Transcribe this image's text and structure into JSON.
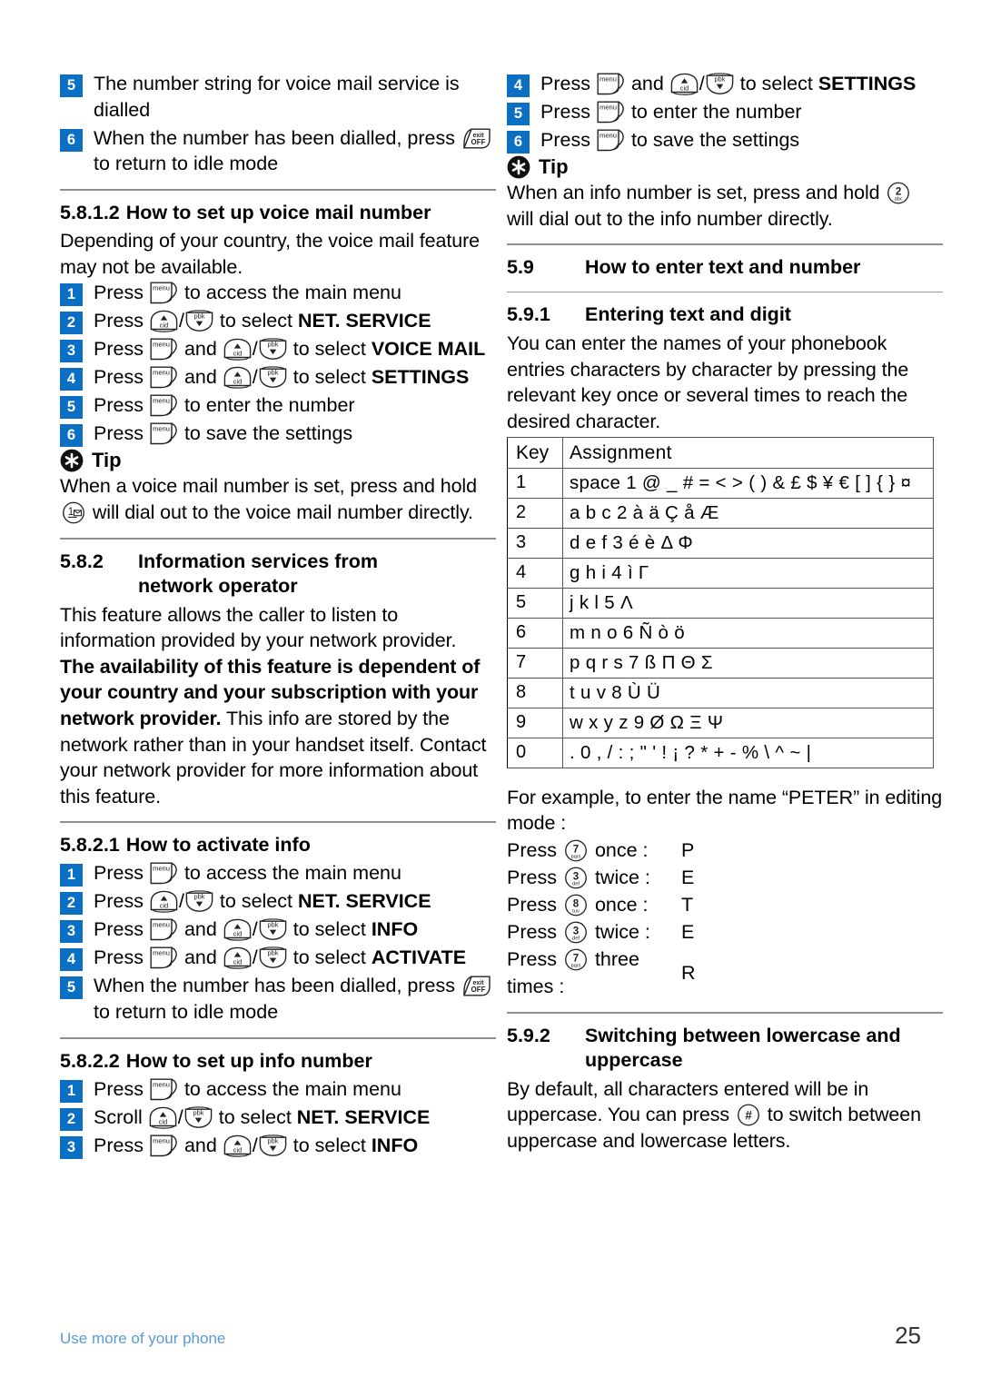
{
  "footer": {
    "left": "Use more of your phone",
    "page": "25"
  },
  "colors": {
    "step_badge": "#0b6fc4",
    "footer_link": "#5b9bd5",
    "rule": "#8e8e8e"
  },
  "left_column": {
    "steps_continued": [
      {
        "num": "5",
        "text": "The number string for voice mail service is dialled"
      },
      {
        "num": "6",
        "pre": "When the number has been dialled, press",
        "icon": "exit-off-key-icon",
        "post": "to return to idle mode"
      }
    ],
    "s_58_1_2": {
      "number": "5.8.1.2",
      "title": "How to set up voice mail number",
      "intro": "Depending of your country, the voice mail feature may not be available.",
      "steps": [
        {
          "num": "1",
          "pre": "Press",
          "icons": [
            "menu-key-icon"
          ],
          "post": "to access the main menu"
        },
        {
          "num": "2",
          "pre": "Press",
          "icons": [
            "up-cid-key-icon",
            "down-pbk-key-icon"
          ],
          "post": "to select",
          "bold": "NET. SERVICE"
        },
        {
          "num": "3",
          "pre": "Press",
          "icons": [
            "menu-key-icon",
            "up-cid-key-icon",
            "down-pbk-key-icon"
          ],
          "mid": "and",
          "post": "to select",
          "bold": "VOICE MAIL"
        },
        {
          "num": "4",
          "pre": "Press",
          "icons": [
            "menu-key-icon",
            "up-cid-key-icon",
            "down-pbk-key-icon"
          ],
          "mid": "and",
          "post": "to select",
          "bold": "SETTINGS"
        },
        {
          "num": "5",
          "pre": "Press",
          "icons": [
            "menu-key-icon"
          ],
          "post": "to enter the number"
        },
        {
          "num": "6",
          "pre": "Press",
          "icons": [
            "menu-key-icon"
          ],
          "post": "to save the settings"
        }
      ],
      "tip": {
        "label": "Tip",
        "text_a": "When a voice mail number is set, press and hold",
        "icon": "voicemail-1-key-icon",
        "text_b": "will dial out to the voice mail number directly."
      }
    },
    "s_58_2": {
      "number": "5.8.2",
      "title_line1": "Information services from",
      "title_line2": "network operator",
      "body_a": "This feature allows the caller to listen to information provided by your network provider.",
      "body_bold": "The availability of this feature is dependent of your country and your subscription with your network provider.",
      "body_b": "This info are stored by the network rather than in your handset itself. Contact your network provider for more information about this feature."
    },
    "s_58_2_1": {
      "number": "5.8.2.1",
      "title": "How to activate info",
      "steps": [
        {
          "num": "1",
          "pre": "Press",
          "icons": [
            "menu-key-icon"
          ],
          "post": "to access the main menu"
        },
        {
          "num": "2",
          "pre": "Press",
          "icons": [
            "up-cid-key-icon",
            "down-pbk-key-icon"
          ],
          "post": "to select",
          "bold": "NET. SERVICE"
        },
        {
          "num": "3",
          "pre": "Press",
          "icons": [
            "menu-key-icon",
            "up-cid-key-icon",
            "down-pbk-key-icon"
          ],
          "mid": "and",
          "post": "to select",
          "bold": "INFO"
        },
        {
          "num": "4",
          "pre": "Press",
          "icons": [
            "menu-key-icon",
            "up-cid-key-icon",
            "down-pbk-key-icon"
          ],
          "mid": "and",
          "post": "to select",
          "bold": "ACTIVATE"
        },
        {
          "num": "5",
          "pre": "When the number has been dialled, press",
          "icons": [
            "exit-off-key-icon"
          ],
          "post": "to return to idle mode"
        }
      ]
    },
    "s_58_2_2": {
      "number": "5.8.2.2",
      "title": "How to set up info number",
      "steps": [
        {
          "num": "1",
          "pre": "Press",
          "icons": [
            "menu-key-icon"
          ],
          "post": "to access the main menu"
        },
        {
          "num": "2",
          "pre": "Scroll",
          "icons": [
            "up-cid-key-icon",
            "down-pbk-key-icon"
          ],
          "post": "to select",
          "bold": "NET. SERVICE"
        },
        {
          "num": "3",
          "pre": "Press",
          "icons": [
            "menu-key-icon",
            "up-cid-key-icon",
            "down-pbk-key-icon"
          ],
          "mid": "and",
          "post": "to select",
          "bold": "INFO"
        }
      ]
    }
  },
  "right_column": {
    "steps_continued": [
      {
        "num": "4",
        "pre": "Press",
        "icons": [
          "menu-key-icon",
          "up-cid-key-icon",
          "down-pbk-key-icon"
        ],
        "mid": "and",
        "post": "to select",
        "bold": "SETTINGS"
      },
      {
        "num": "5",
        "pre": "Press",
        "icons": [
          "menu-key-icon"
        ],
        "post": "to enter the number"
      },
      {
        "num": "6",
        "pre": "Press",
        "icons": [
          "menu-key-icon"
        ],
        "post": "to save the settings"
      }
    ],
    "tip": {
      "label": "Tip",
      "text_a": "When an info number is set, press and hold",
      "icon": "digit-2-abc-key-icon",
      "text_b": "will dial out to the info number directly."
    },
    "s_59": {
      "number": "5.9",
      "title": "How to enter text and number"
    },
    "s_59_1": {
      "number": "5.9.1",
      "title": "Entering text and digit",
      "intro": "You can enter the names of your phonebook entries characters by character by pressing the relevant key once or several times to reach the desired character.",
      "table": {
        "headers": [
          "Key",
          "Assignment"
        ],
        "rows": [
          {
            "key": "1",
            "assignment": "space 1 @ _ # = < > ( ) & £ $ ¥ € [ ] { } ¤"
          },
          {
            "key": "2",
            "assignment": "a b c 2 à ä Ç å Æ"
          },
          {
            "key": "3",
            "assignment": "d e f 3 é è Δ Φ"
          },
          {
            "key": "4",
            "assignment": "g h i 4 ì Γ"
          },
          {
            "key": "5",
            "assignment": "j k l 5 Λ"
          },
          {
            "key": "6",
            "assignment": "m n o 6 Ñ ò ö"
          },
          {
            "key": "7",
            "assignment": "p q r s 7 ß Π Θ Σ"
          },
          {
            "key": "8",
            "assignment": "t u v 8 Ù Ü"
          },
          {
            "key": "9",
            "assignment": "w x y z 9 Ø Ω Ξ Ψ"
          },
          {
            "key": "0",
            "assignment": ". 0 , / : ; \" ' ! ¡ ? * + - % \\ ^ ~ |"
          }
        ]
      },
      "example_intro": "For example, to enter the name “PETER” in editing mode :",
      "example_rows": [
        {
          "press": "Press",
          "icon": "digit-7-pqrs-key-icon",
          "times": "once :",
          "result": "P"
        },
        {
          "press": "Press",
          "icon": "digit-3-def-key-icon",
          "times": "twice :",
          "result": "E"
        },
        {
          "press": "Press",
          "icon": "digit-8-tuv-key-icon",
          "times": "once :",
          "result": "T"
        },
        {
          "press": "Press",
          "icon": "digit-3-def-key-icon",
          "times": "twice :",
          "result": "E"
        },
        {
          "press": "Press",
          "icon": "digit-7-pqrs-key-icon",
          "times": "three times :",
          "result": "R"
        }
      ]
    },
    "s_59_2": {
      "number": "5.9.2",
      "title_line1": "Switching between lowercase and",
      "title_line2": "uppercase",
      "body_a": "By default, all characters entered will be in uppercase. You can press",
      "icon": "hash-key-icon",
      "body_b": "to switch between uppercase and lowercase letters."
    }
  }
}
